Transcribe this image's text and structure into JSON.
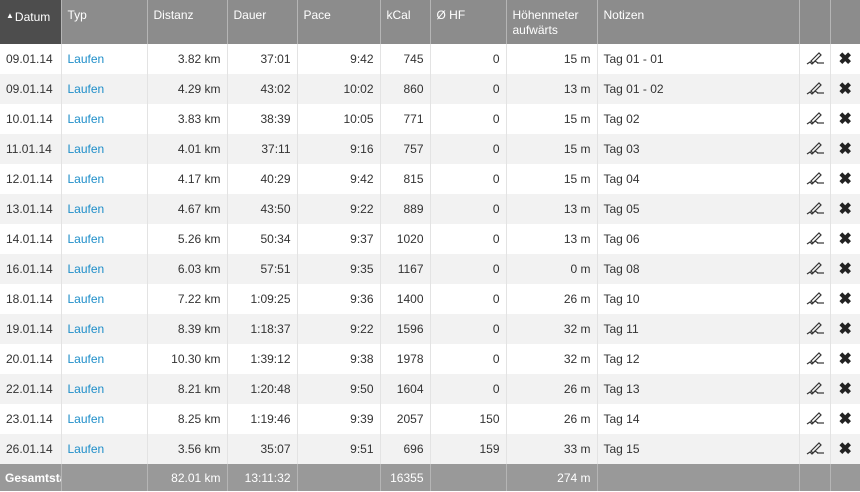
{
  "headers": {
    "datum": "Datum",
    "typ": "Typ",
    "distanz": "Distanz",
    "dauer": "Dauer",
    "pace": "Pace",
    "kcal": "kCal",
    "hf": "Ø HF",
    "hoehenmeter_line1": "Höhenmeter",
    "hoehenmeter_line2": "aufwärts",
    "notizen": "Notizen"
  },
  "sort": {
    "column": "datum",
    "direction": "ascending",
    "icon": "sort-up-triangle"
  },
  "rows": [
    {
      "date": "09.01.14",
      "type": "Laufen",
      "distance": "3.82 km",
      "duration": "37:01",
      "pace": "9:42",
      "kcal": "745",
      "hf": "0",
      "elevation": "15 m",
      "note": "Tag 01 - 01"
    },
    {
      "date": "09.01.14",
      "type": "Laufen",
      "distance": "4.29 km",
      "duration": "43:02",
      "pace": "10:02",
      "kcal": "860",
      "hf": "0",
      "elevation": "13 m",
      "note": "Tag 01 - 02"
    },
    {
      "date": "10.01.14",
      "type": "Laufen",
      "distance": "3.83 km",
      "duration": "38:39",
      "pace": "10:05",
      "kcal": "771",
      "hf": "0",
      "elevation": "15 m",
      "note": "Tag 02"
    },
    {
      "date": "11.01.14",
      "type": "Laufen",
      "distance": "4.01 km",
      "duration": "37:11",
      "pace": "9:16",
      "kcal": "757",
      "hf": "0",
      "elevation": "15 m",
      "note": "Tag 03"
    },
    {
      "date": "12.01.14",
      "type": "Laufen",
      "distance": "4.17 km",
      "duration": "40:29",
      "pace": "9:42",
      "kcal": "815",
      "hf": "0",
      "elevation": "15 m",
      "note": "Tag 04"
    },
    {
      "date": "13.01.14",
      "type": "Laufen",
      "distance": "4.67 km",
      "duration": "43:50",
      "pace": "9:22",
      "kcal": "889",
      "hf": "0",
      "elevation": "13 m",
      "note": "Tag 05"
    },
    {
      "date": "14.01.14",
      "type": "Laufen",
      "distance": "5.26 km",
      "duration": "50:34",
      "pace": "9:37",
      "kcal": "1020",
      "hf": "0",
      "elevation": "13 m",
      "note": "Tag 06"
    },
    {
      "date": "16.01.14",
      "type": "Laufen",
      "distance": "6.03 km",
      "duration": "57:51",
      "pace": "9:35",
      "kcal": "1167",
      "hf": "0",
      "elevation": "0 m",
      "note": "Tag 08"
    },
    {
      "date": "18.01.14",
      "type": "Laufen",
      "distance": "7.22 km",
      "duration": "1:09:25",
      "pace": "9:36",
      "kcal": "1400",
      "hf": "0",
      "elevation": "26 m",
      "note": "Tag 10"
    },
    {
      "date": "19.01.14",
      "type": "Laufen",
      "distance": "8.39 km",
      "duration": "1:18:37",
      "pace": "9:22",
      "kcal": "1596",
      "hf": "0",
      "elevation": "32 m",
      "note": "Tag 11"
    },
    {
      "date": "20.01.14",
      "type": "Laufen",
      "distance": "10.30 km",
      "duration": "1:39:12",
      "pace": "9:38",
      "kcal": "1978",
      "hf": "0",
      "elevation": "32 m",
      "note": "Tag 12"
    },
    {
      "date": "22.01.14",
      "type": "Laufen",
      "distance": "8.21 km",
      "duration": "1:20:48",
      "pace": "9:50",
      "kcal": "1604",
      "hf": "0",
      "elevation": "26 m",
      "note": "Tag 13"
    },
    {
      "date": "23.01.14",
      "type": "Laufen",
      "distance": "8.25 km",
      "duration": "1:19:46",
      "pace": "9:39",
      "kcal": "2057",
      "hf": "150",
      "elevation": "26 m",
      "note": "Tag 14"
    },
    {
      "date": "26.01.14",
      "type": "Laufen",
      "distance": "3.56 km",
      "duration": "35:07",
      "pace": "9:51",
      "kcal": "696",
      "hf": "159",
      "elevation": "33 m",
      "note": "Tag 15"
    }
  ],
  "row_icons": {
    "edit": "edit-pencil-icon",
    "delete": "delete-x-icon"
  },
  "footer": {
    "label": "Gesamtstatistik",
    "distance": "82.01 km",
    "duration": "13:11:32",
    "kcal": "16355",
    "elevation": "274 m"
  },
  "colors": {
    "header_bg": "#8c8c8c",
    "sorted_header_bg": "#4d4d4d",
    "footer_bg": "#999999",
    "link": "#1e8ec9",
    "zebra": "#f2f2f2"
  }
}
